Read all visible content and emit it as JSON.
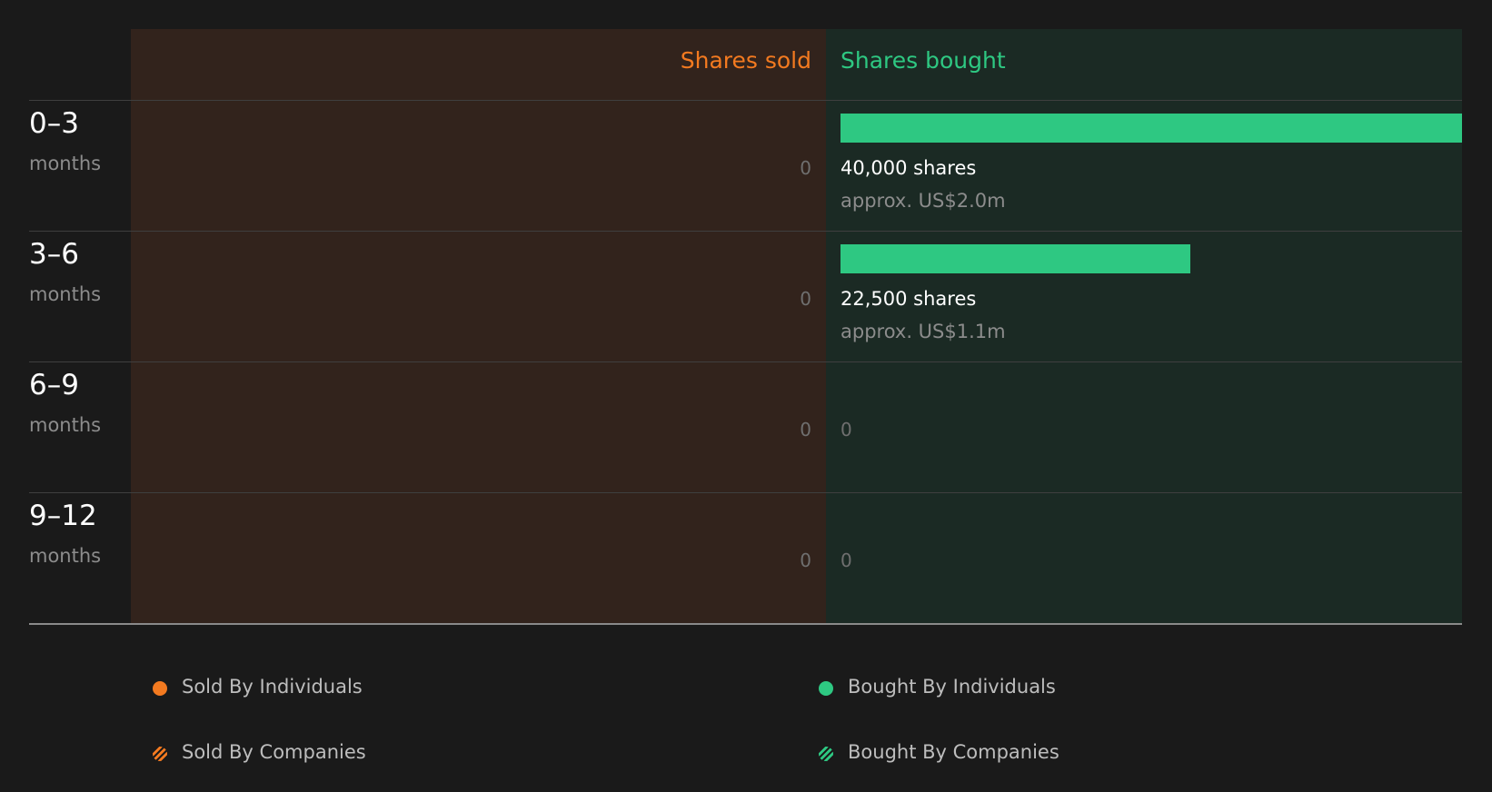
{
  "chart_data": {
    "type": "bar",
    "orientation": "horizontal-diverging",
    "headers": {
      "sold": "Shares sold",
      "bought": "Shares bought"
    },
    "unit_label": "months",
    "categories": [
      "0–3",
      "3–6",
      "6–9",
      "9–12"
    ],
    "series": [
      {
        "name": "Shares sold",
        "values": [
          0,
          0,
          0,
          0
        ],
        "labels": [
          "0",
          "0",
          "0",
          "0"
        ]
      },
      {
        "name": "Shares bought",
        "values": [
          40000,
          22500,
          0,
          0
        ],
        "labels": [
          "40,000 shares",
          "22,500 shares",
          "0",
          "0"
        ],
        "approx": [
          "approx. US$2.0m",
          "approx. US$1.1m",
          "",
          ""
        ]
      }
    ],
    "xlim_bought": [
      0,
      40000
    ],
    "legend": [
      {
        "label": "Sold By Individuals",
        "color": "#f37a20",
        "pattern": "solid"
      },
      {
        "label": "Bought By Individuals",
        "color": "#2ec882",
        "pattern": "solid"
      },
      {
        "label": "Sold By Companies",
        "color": "#f37a20",
        "pattern": "hatched"
      },
      {
        "label": "Bought By Companies",
        "color": "#2ec882",
        "pattern": "hatched"
      }
    ],
    "legend_position": "bottom",
    "colors": {
      "sold": "#f37a20",
      "bought": "#2ec882",
      "background": "#1a1a1a"
    }
  }
}
